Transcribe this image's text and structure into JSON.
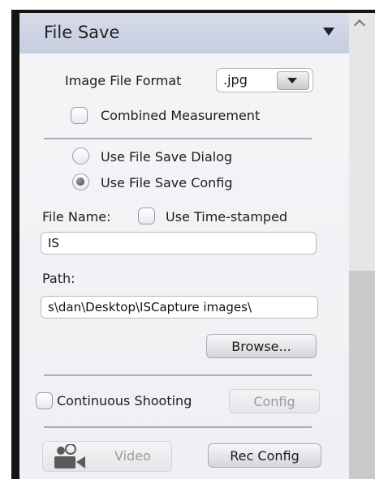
{
  "panel": {
    "title": "File Save",
    "image_format": {
      "label": "Image File Format",
      "value": ".jpg"
    },
    "combined_measurement": {
      "label": "Combined Measurement",
      "checked": false
    },
    "save_mode": {
      "options": [
        {
          "label": "Use File Save Dialog",
          "selected": false
        },
        {
          "label": "Use File Save Config",
          "selected": true
        }
      ]
    },
    "file_name": {
      "label": "File Name:",
      "timestamp_label": "Use Time-stamped",
      "timestamp_checked": false,
      "value": "IS"
    },
    "path": {
      "label": "Path:",
      "value": "s\\dan\\Desktop\\ISCapture images\\"
    },
    "browse_label": "Browse...",
    "continuous": {
      "label": "Continuous Shooting",
      "checked": false,
      "config_label": "Config"
    },
    "video": {
      "label": "Video",
      "camera_icon": "video-camera-icon",
      "rec_config_label": "Rec Config"
    }
  },
  "colors": {
    "header": "#c9d0e2",
    "panel_bg": "#f1f2f5",
    "frame": "#141414"
  }
}
